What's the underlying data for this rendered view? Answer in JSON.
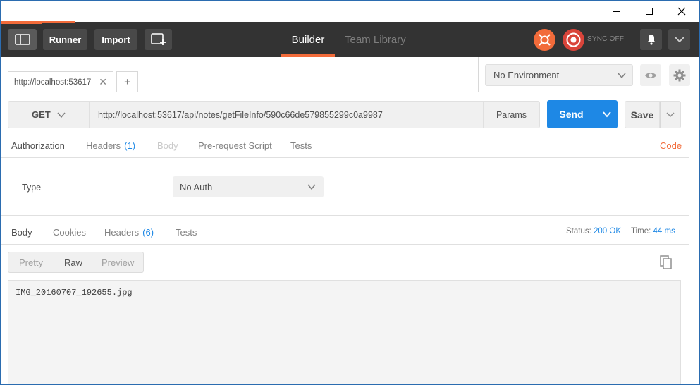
{
  "window": {
    "minimize_icon": "minimize-icon",
    "maximize_icon": "maximize-icon",
    "close_icon": "close-icon"
  },
  "header": {
    "runner_label": "Runner",
    "import_label": "Import",
    "tabs": [
      {
        "label": "Builder",
        "active": true
      },
      {
        "label": "Team Library",
        "active": false
      }
    ],
    "sync_label": "SYNC OFF",
    "accent_color": "#f26b3a"
  },
  "request_tab": {
    "title": "http://localhost:53617",
    "close_glyph": "✕",
    "new_tab_glyph": "+"
  },
  "environment": {
    "selected": "No Environment"
  },
  "request": {
    "method": "GET",
    "url": "http://localhost:53617/api/notes/getFileInfo/590c66de579855299c0a9987",
    "params_label": "Params",
    "send_label": "Send",
    "save_label": "Save",
    "send_color": "#1e88e5"
  },
  "request_tabs": {
    "authorization": "Authorization",
    "headers": "Headers",
    "headers_count": "(1)",
    "body": "Body",
    "pre_request": "Pre-request Script",
    "tests": "Tests",
    "code": "Code"
  },
  "auth": {
    "type_label": "Type",
    "type_value": "No Auth"
  },
  "response_tabs": {
    "body": "Body",
    "cookies": "Cookies",
    "headers": "Headers",
    "headers_count": "(6)",
    "tests": "Tests",
    "status_label": "Status:",
    "status_value": "200 OK",
    "time_label": "Time:",
    "time_value": "44 ms"
  },
  "viewer": {
    "pretty": "Pretty",
    "raw": "Raw",
    "preview": "Preview",
    "selected": "Raw"
  },
  "response": {
    "body_text": "IMG_20160707_192655.jpg"
  }
}
